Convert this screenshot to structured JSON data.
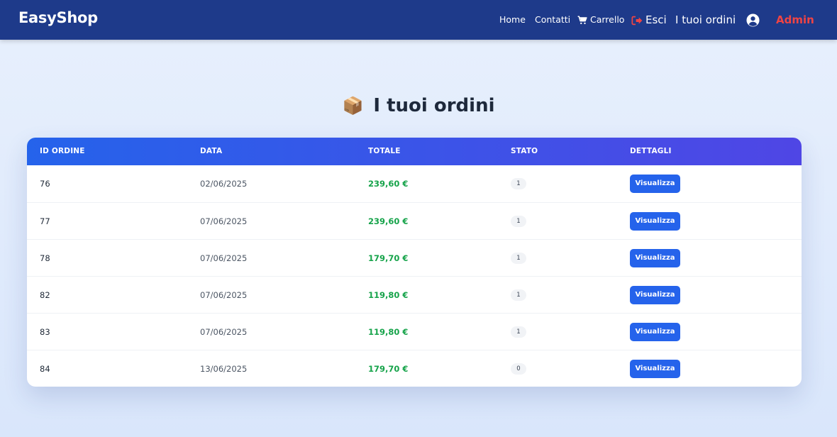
{
  "navbar": {
    "brand": "EasyShop",
    "home": "Home",
    "contacts": "Contatti",
    "cart": "Carrello",
    "logout": "Esci",
    "orders": "I tuoi ordini",
    "admin": "Admin",
    "icons": {
      "cart": "cart-icon",
      "logout": "logout-icon",
      "user": "user-circle-icon"
    },
    "colors": {
      "background": "#1e3a8a",
      "logout_icon": "#ef4444",
      "admin": "#ef4444"
    }
  },
  "page": {
    "title_icon": "📦",
    "title": "I tuoi ordini"
  },
  "table": {
    "headers": [
      "ID ORDINE",
      "DATA",
      "TOTALE",
      "STATO",
      "DETTAGLI"
    ],
    "rows": [
      {
        "id": "76",
        "date": "02/06/2025",
        "total": "239,60 €",
        "status": "1",
        "action": "Visualizza"
      },
      {
        "id": "77",
        "date": "07/06/2025",
        "total": "239,60 €",
        "status": "1",
        "action": "Visualizza"
      },
      {
        "id": "78",
        "date": "07/06/2025",
        "total": "179,70 €",
        "status": "1",
        "action": "Visualizza"
      },
      {
        "id": "82",
        "date": "07/06/2025",
        "total": "119,80 €",
        "status": "1",
        "action": "Visualizza"
      },
      {
        "id": "83",
        "date": "07/06/2025",
        "total": "119,80 €",
        "status": "1",
        "action": "Visualizza"
      },
      {
        "id": "84",
        "date": "13/06/2025",
        "total": "179,70 €",
        "status": "0",
        "action": "Visualizza"
      }
    ],
    "colors": {
      "header_gradient_start": "#2563eb",
      "header_gradient_end": "#4f46e5",
      "total_text": "#16a34a",
      "button": "#2563eb"
    }
  }
}
